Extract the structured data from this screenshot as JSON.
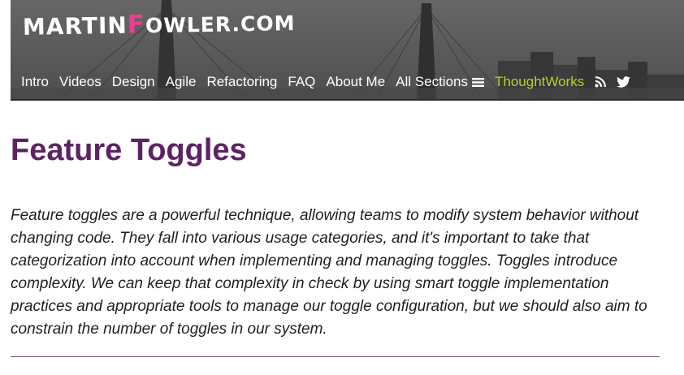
{
  "site": {
    "logo": {
      "part1": "MARTIN",
      "accent": "F",
      "part2": "OWLER",
      "part3": ".COM"
    }
  },
  "nav": {
    "items": [
      {
        "label": "Intro"
      },
      {
        "label": "Videos"
      },
      {
        "label": "Design"
      },
      {
        "label": "Agile"
      },
      {
        "label": "Refactoring"
      },
      {
        "label": "FAQ"
      },
      {
        "label": "About Me"
      },
      {
        "label": "All Sections"
      }
    ],
    "thoughtworks": "ThoughtWorks",
    "icons": [
      "hamburger-icon",
      "rss-icon",
      "twitter-icon"
    ],
    "colors": {
      "link": "#ffffff",
      "thoughtworks": "#b9cf2d"
    }
  },
  "article": {
    "title": "Feature Toggles",
    "intro": "Feature toggles are a powerful technique, allowing teams to modify system behavior without changing code. They fall into various usage categories, and it's important to take that categorization into account when implementing and managing toggles. Toggles introduce complexity. We can keep that complexity in check by using smart toggle implementation practices and appropriate tools to manage our toggle configuration, but we should also aim to constrain the number of toggles in our system."
  },
  "colors": {
    "title": "#5c2363",
    "logo_accent": "#ee3d8f",
    "header_bg": "#5a5a5a"
  }
}
